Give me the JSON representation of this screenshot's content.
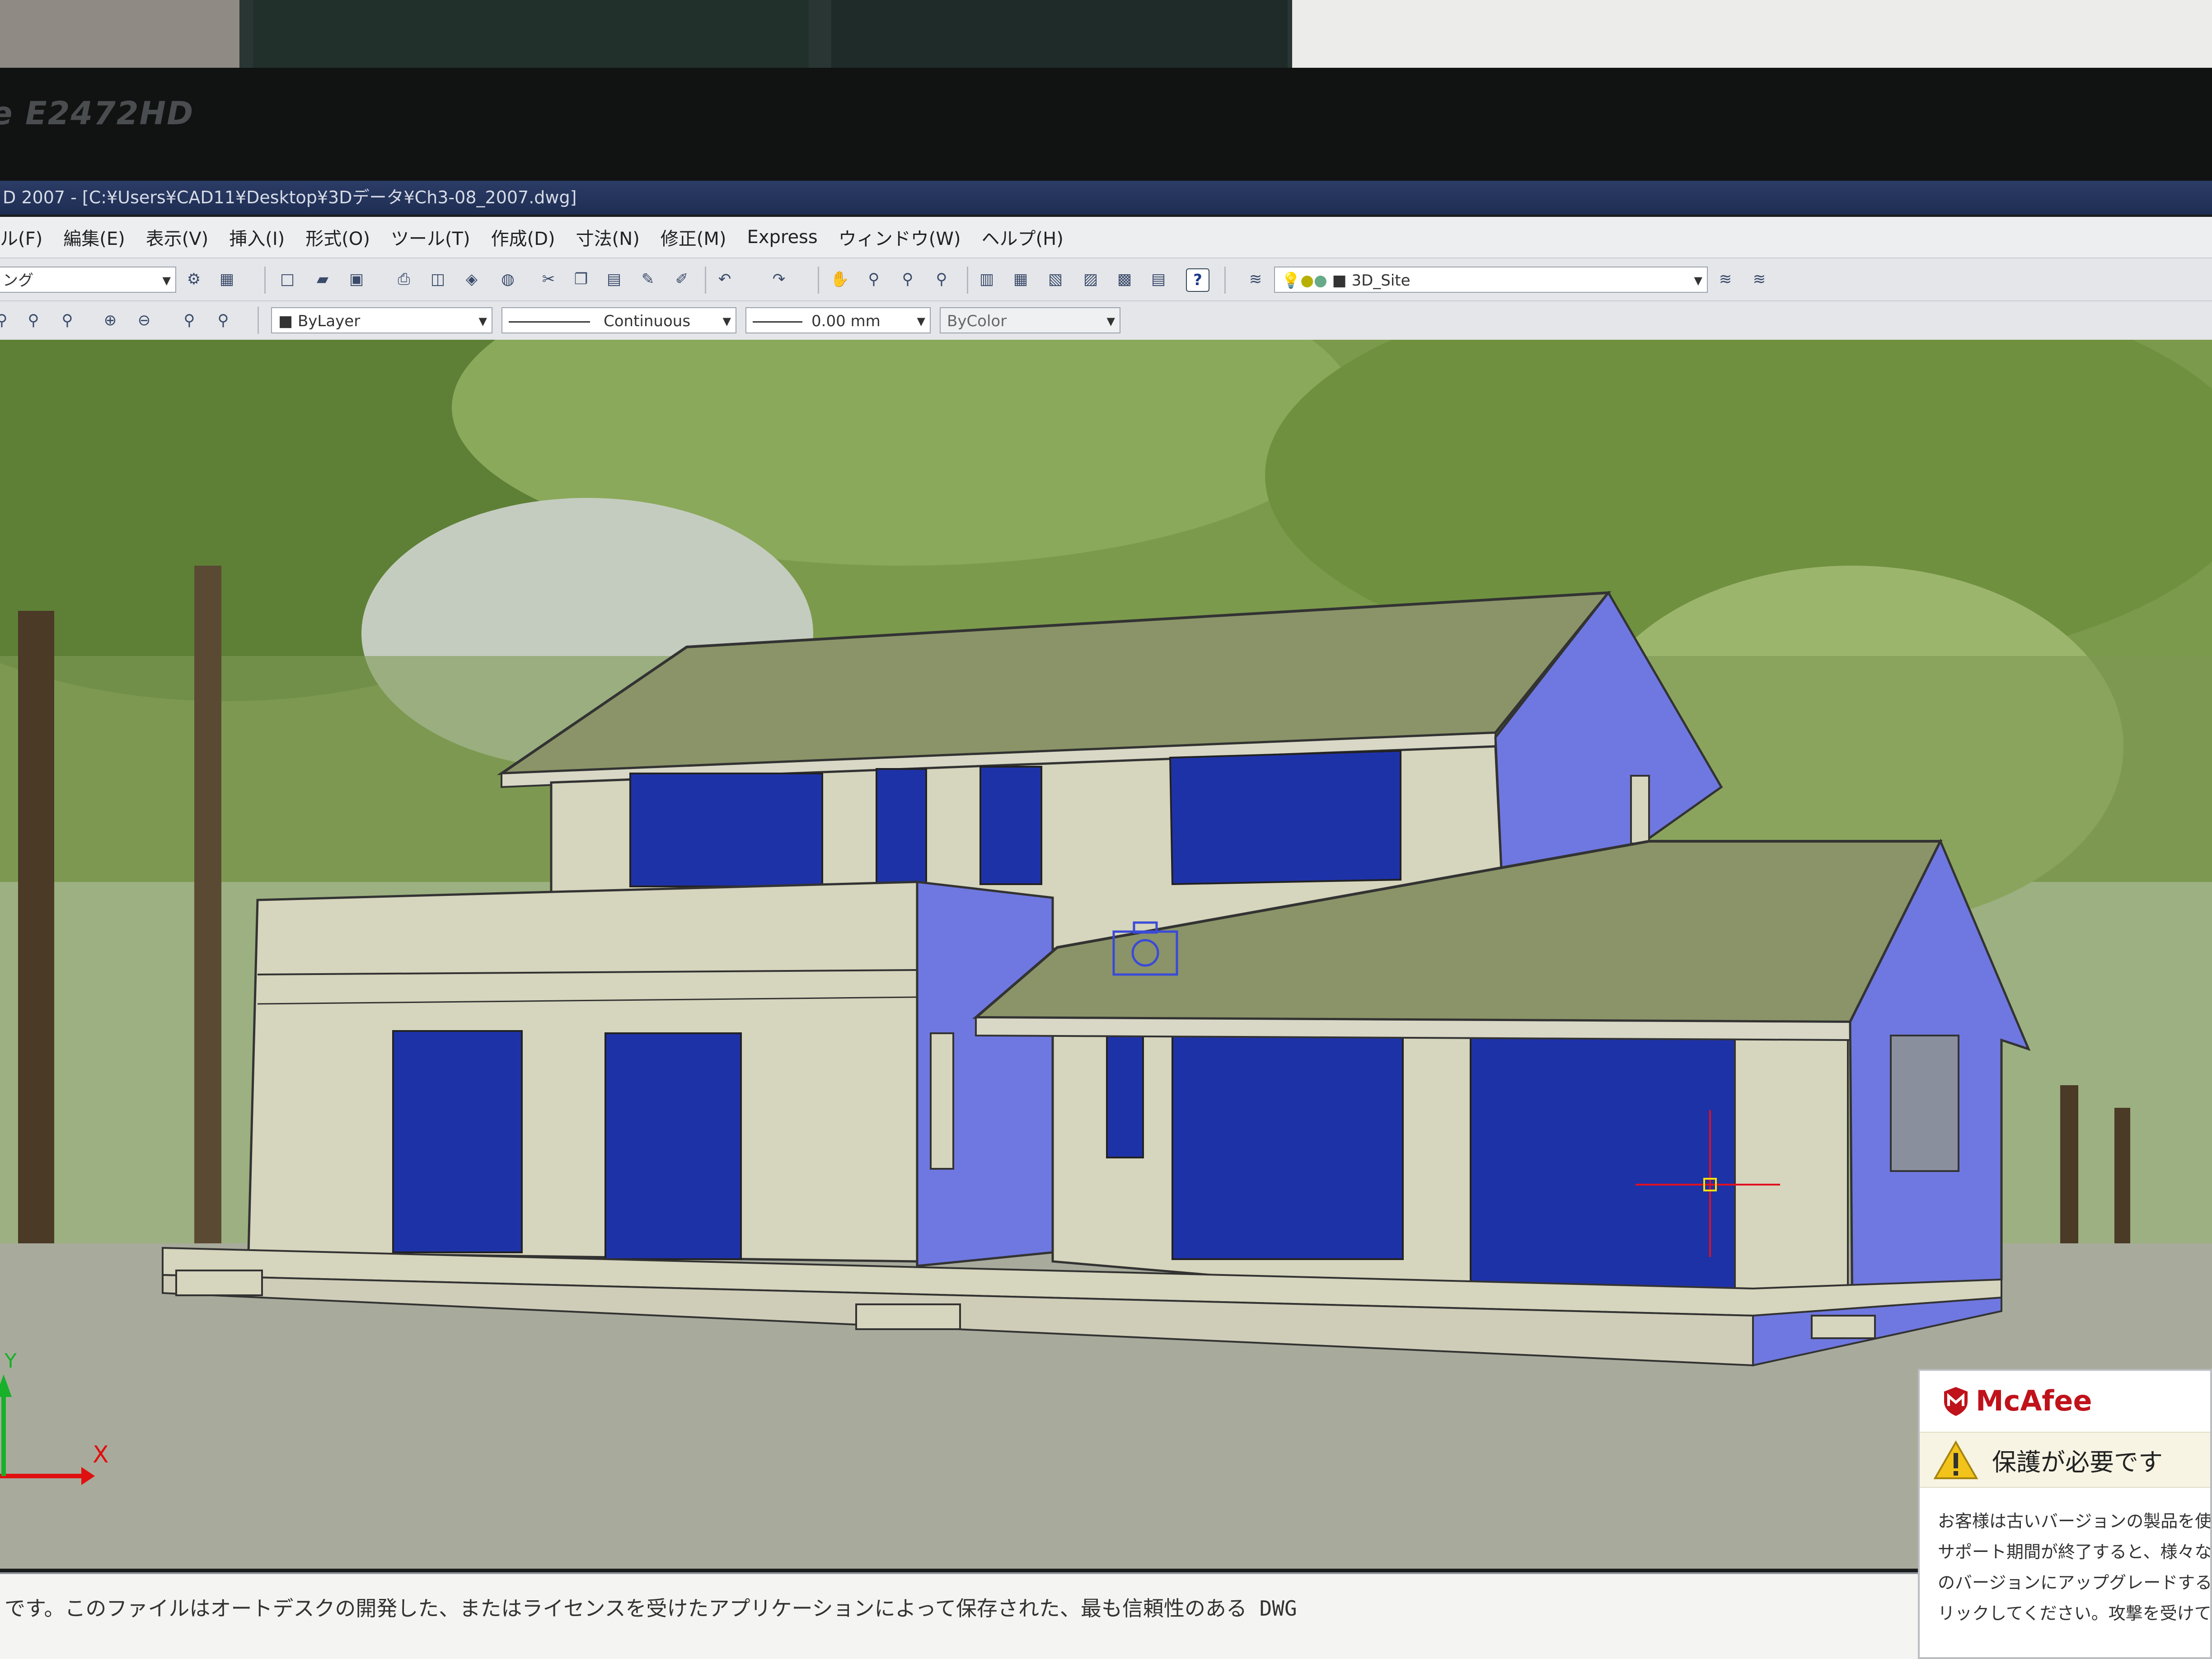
{
  "monitor": {
    "model": "E2472HD"
  },
  "app": {
    "title": "D 2007 - [C:¥Users¥CAD11¥Desktop¥3Dデータ¥Ch3-08_2007.dwg]"
  },
  "menu": {
    "items": [
      "ル(F)",
      "編集(E)",
      "表示(V)",
      "挿入(I)",
      "形式(O)",
      "ツール(T)",
      "作成(D)",
      "寸法(N)",
      "修正(M)",
      "Express",
      "ウィンドウ(W)",
      "ヘルプ(H)"
    ]
  },
  "toolbar": {
    "workspace_value": "ング",
    "layer_value": "3D_Site",
    "color_value": "ByLayer",
    "linetype_value": "Continuous",
    "lineweight_value": "0.00 mm",
    "plotstyle_value": "ByColor",
    "icons": [
      "zoom-realtime-icon",
      "zoom-window-icon",
      "zoom-previous-icon",
      "zoom-in-icon",
      "zoom-out-icon",
      "zoom-all-icon",
      "zoom-extents-icon",
      "new-icon",
      "open-icon",
      "save-icon",
      "plot-icon",
      "plot-preview-icon",
      "publish-icon",
      "3d-dwf-icon",
      "cut-icon",
      "copy-icon",
      "paste-icon",
      "match-properties-icon",
      "block-editor-icon",
      "undo-icon",
      "redo-icon",
      "pan-icon",
      "zoom-realtime-icon",
      "zoom-window-icon",
      "zoom-previous-icon",
      "properties-icon",
      "design-center-icon",
      "tool-palettes-icon",
      "sheet-set-icon",
      "markup-icon",
      "quickcalc-icon",
      "help-icon",
      "layer-properties-icon",
      "layer-previous-icon",
      "layer-state-icon"
    ]
  },
  "viewport": {
    "ucs_labels": {
      "x": "X",
      "y": "Y"
    },
    "colors": {
      "roof": "#8a9468",
      "wall": "#d6d5bd",
      "glass": "#1e32a8",
      "side_wall": "#6f78e0",
      "ground": "#a8ab9b"
    }
  },
  "command_line": {
    "text": "です。このファイルはオートデスクの開発した、またはライセンスを受けたアプリケーションによって保存された、最も信頼性のある DWG"
  },
  "mcafee": {
    "brand": "McAfee",
    "alert": "保護が必要です",
    "body_lines": [
      "お客様は古いバージョンの製品を使",
      "サポート期間が終了すると、様々な",
      "のバージョンにアップグレードする必",
      "リックしてください。攻撃を受けてか"
    ],
    "icons": [
      "mcafee-shield-icon",
      "warning-icon"
    ]
  }
}
